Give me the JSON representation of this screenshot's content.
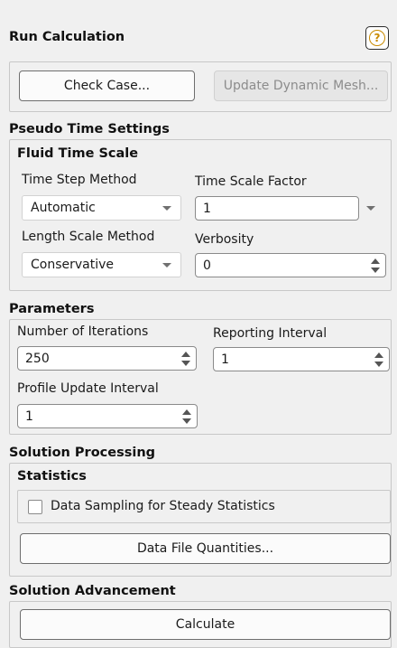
{
  "header": {
    "title": "Run Calculation",
    "help_glyph": "?"
  },
  "buttons": {
    "check_case": "Check Case...",
    "update_dynamic_mesh": "Update Dynamic Mesh...",
    "data_file_quantities": "Data File Quantities...",
    "calculate": "Calculate"
  },
  "pseudo_time": {
    "title": "Pseudo Time Settings",
    "fluid_time_scale": {
      "title": "Fluid Time Scale",
      "time_step_method_label": "Time Step Method",
      "time_step_method_value": "Automatic",
      "time_scale_factor_label": "Time Scale Factor",
      "time_scale_factor_value": "1",
      "length_scale_method_label": "Length Scale Method",
      "length_scale_method_value": "Conservative",
      "verbosity_label": "Verbosity",
      "verbosity_value": "0"
    }
  },
  "parameters": {
    "title": "Parameters",
    "iterations_label": "Number of Iterations",
    "iterations_value": "250",
    "reporting_interval_label": "Reporting Interval",
    "reporting_interval_value": "1",
    "profile_update_label": "Profile Update Interval",
    "profile_update_value": "1"
  },
  "solution_processing": {
    "title": "Solution Processing",
    "statistics_title": "Statistics",
    "data_sampling_label": "Data Sampling for Steady Statistics",
    "data_sampling_checked": false
  },
  "solution_advancement": {
    "title": "Solution Advancement"
  }
}
